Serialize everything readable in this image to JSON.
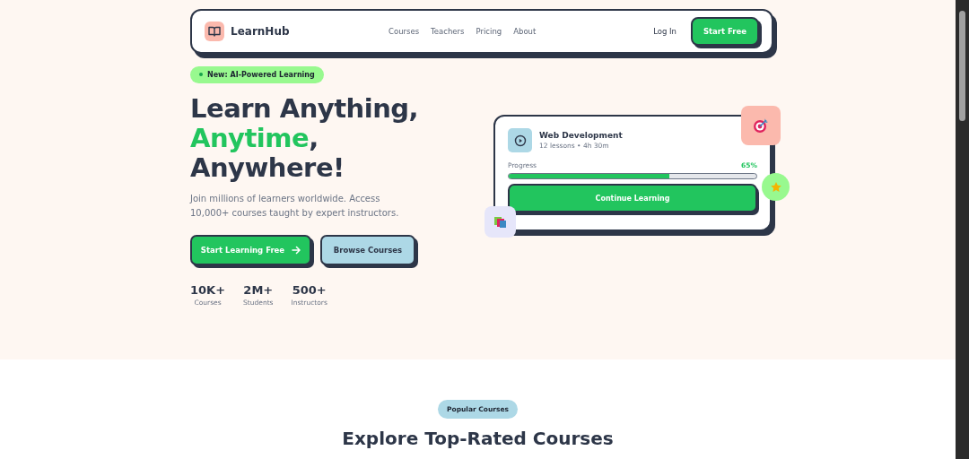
{
  "nav": {
    "logo": "LearnHub",
    "links": [
      "Courses",
      "Teachers",
      "Pricing",
      "About"
    ],
    "login": "Log In",
    "cta": "Start Free"
  },
  "hero": {
    "badge": "New: AI-Powered Learning",
    "heading": [
      [
        {
          "text": "Learn Anything,",
          "highlight": false
        }
      ],
      [
        {
          "text": "Anytime",
          "highlight": true
        },
        {
          "text": ",",
          "highlight": false
        }
      ],
      [
        {
          "text": "Anywhere!",
          "highlight": false
        }
      ]
    ],
    "description": "Join millions of learners worldwide. Access 10,000+ courses taught by expert instructors.",
    "buttons": [
      {
        "label": "Start Learning Free",
        "kind": "primary"
      },
      {
        "label": "Browse Courses",
        "kind": "secondary"
      }
    ],
    "stats": [
      {
        "value": "10K+",
        "label": "Courses"
      },
      {
        "value": "2M+",
        "label": "Students"
      },
      {
        "value": "500+",
        "label": "Instructors"
      }
    ]
  },
  "course_card": {
    "title": "Web Development",
    "meta": "12 lessons • 4h 30m",
    "progress_label": "Progress",
    "progress_reading": "65%",
    "level": 0.65,
    "button": "Continue Learning"
  },
  "section": {
    "badge": "Popular Courses",
    "title": "Explore Top-Rated Courses"
  }
}
